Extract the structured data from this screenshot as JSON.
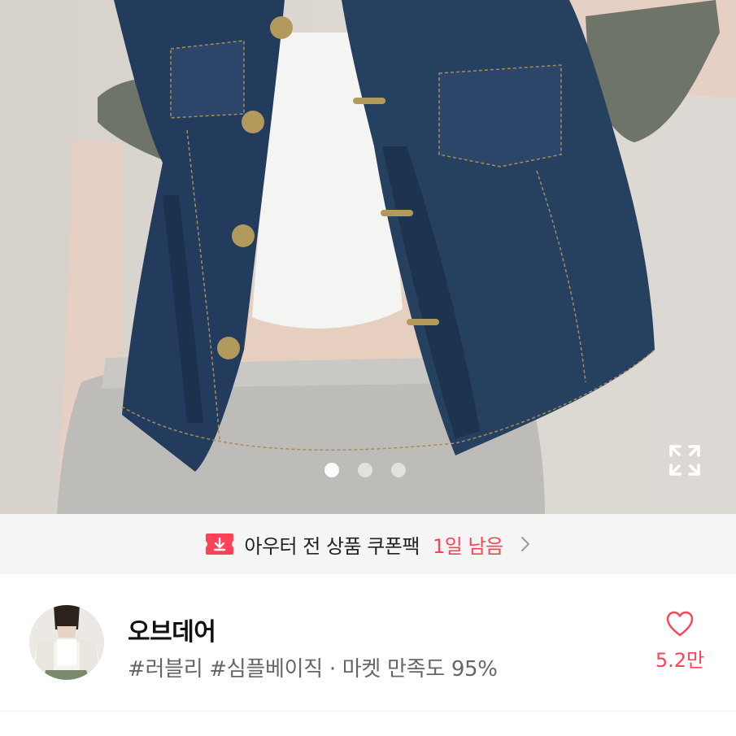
{
  "hero": {
    "image_description_icon": "product-photo",
    "carousel": {
      "page_count": 3,
      "active_index": 0
    },
    "expand_icon": "expand-icon"
  },
  "coupon": {
    "icon": "coupon-download-icon",
    "text": "아우터 전 상품 쿠폰팩",
    "days_left": "1일 남음",
    "chevron_icon": "chevron-right-icon",
    "accent_color": "#ff4257"
  },
  "shop": {
    "name": "오브데어",
    "tags": "#러블리 #심플베이직 · 마켓 만족도 95%",
    "like_count": "5.2만",
    "heart_icon": "heart-outline-icon"
  }
}
